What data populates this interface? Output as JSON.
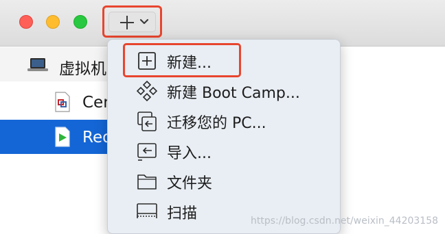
{
  "window": {
    "traffic_lights": {
      "close": "#fe5f57",
      "minimize": "#febc2e",
      "zoom": "#28c840"
    }
  },
  "toolbar": {
    "add_icon": "plus-icon",
    "dropdown_icon": "chevron-down-icon"
  },
  "sidebar": {
    "items": [
      {
        "label": "虚拟机",
        "icon": "laptop-icon"
      },
      {
        "label": "Cen",
        "icon": "vm-file-icon"
      },
      {
        "label": "Red",
        "icon": "play-file-icon",
        "selected": true
      }
    ]
  },
  "menu": {
    "items": [
      {
        "label": "新建...",
        "icon": "plus-square-icon"
      },
      {
        "label": "新建 Boot Camp...",
        "icon": "bootcamp-icon"
      },
      {
        "label": "迁移您的 PC...",
        "icon": "migrate-icon"
      },
      {
        "label": "导入...",
        "icon": "import-icon"
      },
      {
        "label": "文件夹",
        "icon": "folder-icon"
      },
      {
        "label": "扫描",
        "icon": "scan-icon"
      }
    ]
  },
  "accent": {
    "selection": "#1466d6",
    "annotation": "#e8452e"
  },
  "watermark": "https://blog.csdn.net/weixin_44203158"
}
